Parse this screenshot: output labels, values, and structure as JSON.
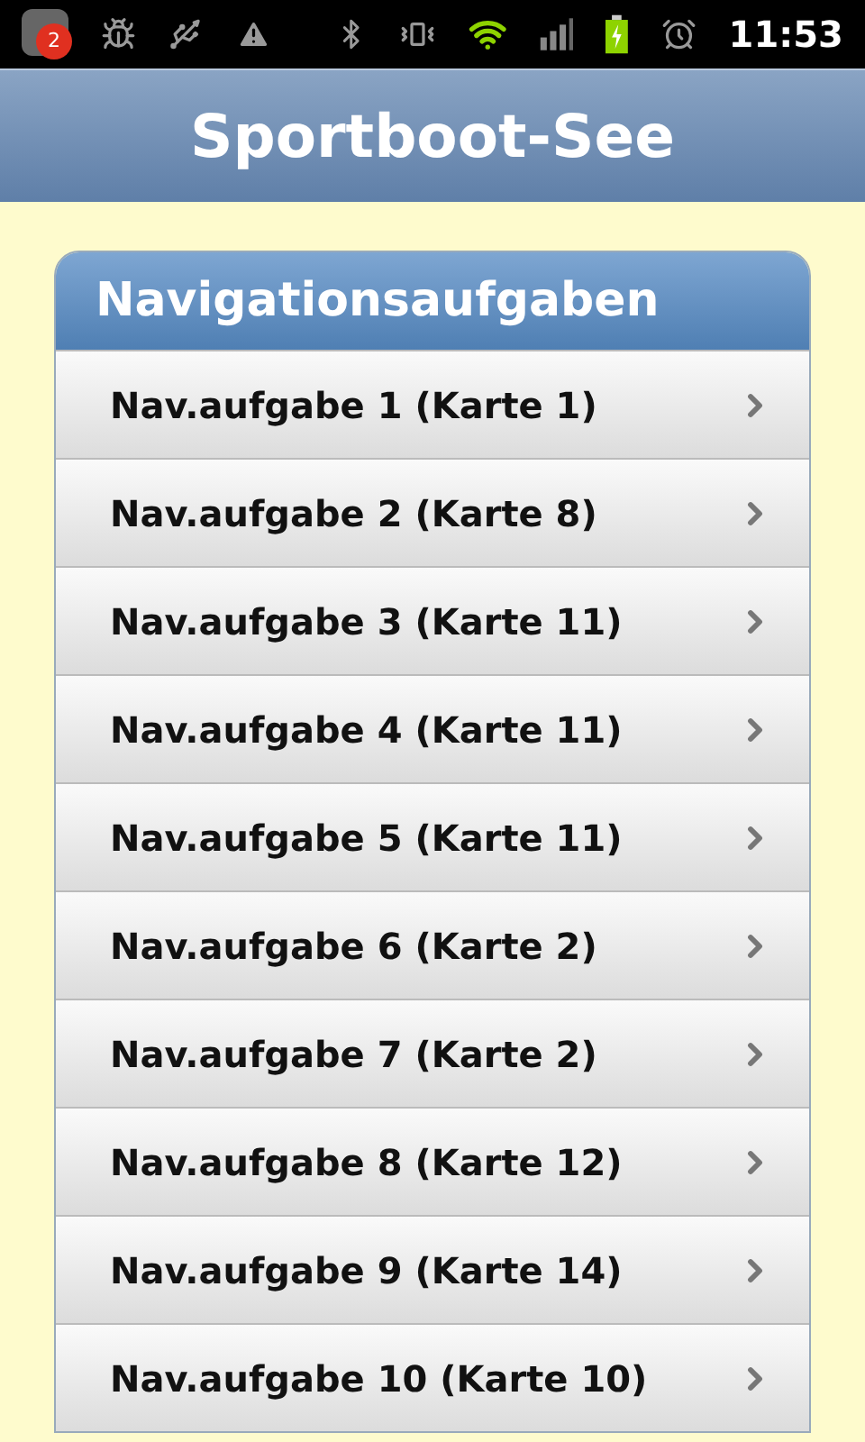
{
  "status_bar": {
    "notification_count": "2",
    "time": "11:53"
  },
  "header": {
    "title": "Sportboot-See"
  },
  "list": {
    "title": "Navigationsaufgaben",
    "items": [
      {
        "label": "Nav.aufgabe 1 (Karte 1)"
      },
      {
        "label": "Nav.aufgabe 2 (Karte 8)"
      },
      {
        "label": "Nav.aufgabe 3 (Karte 11)"
      },
      {
        "label": "Nav.aufgabe 4 (Karte 11)"
      },
      {
        "label": "Nav.aufgabe 5 (Karte 11)"
      },
      {
        "label": "Nav.aufgabe 6 (Karte 2)"
      },
      {
        "label": "Nav.aufgabe 7 (Karte 2)"
      },
      {
        "label": "Nav.aufgabe 8 (Karte 12)"
      },
      {
        "label": "Nav.aufgabe 9 (Karte 14)"
      },
      {
        "label": "Nav.aufgabe 10 (Karte 10)"
      }
    ]
  }
}
